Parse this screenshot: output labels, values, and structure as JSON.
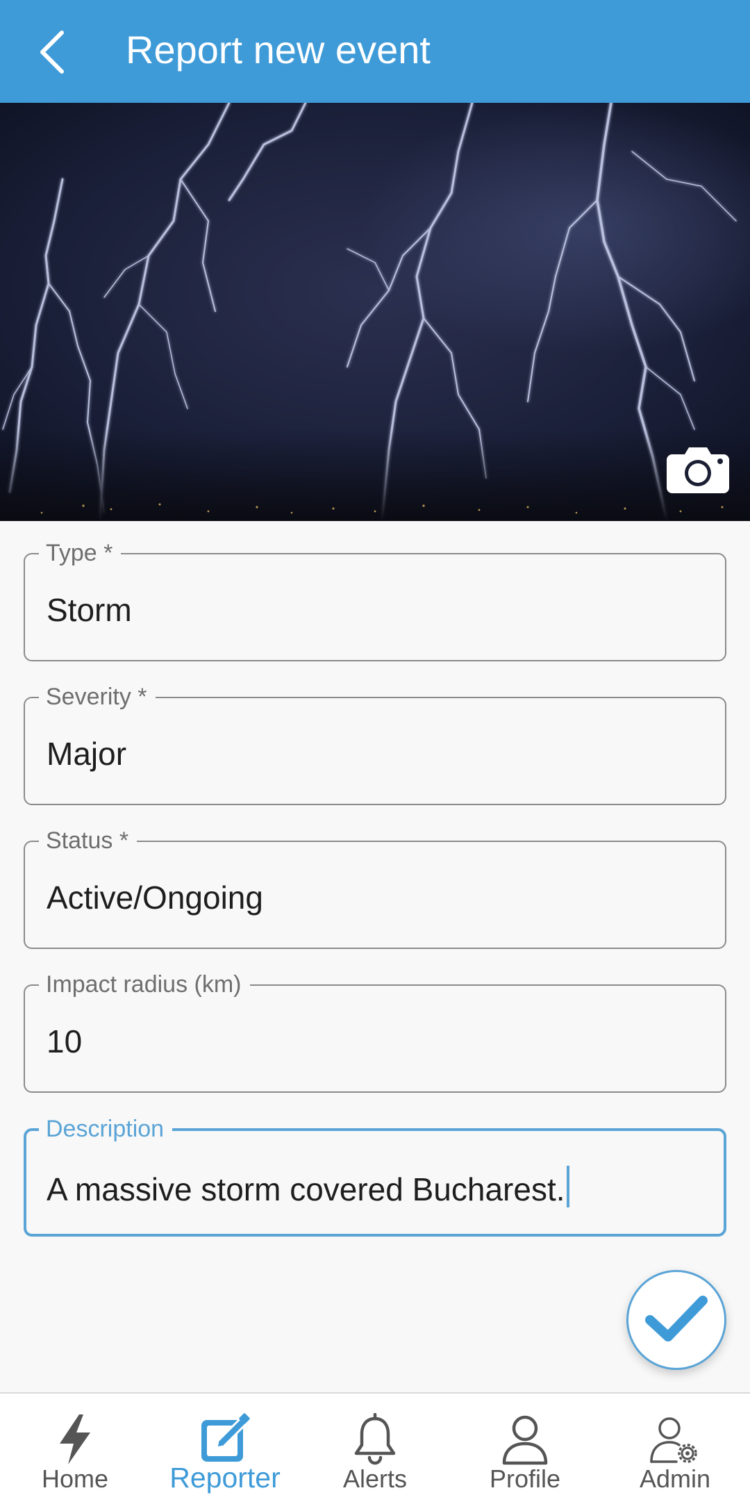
{
  "app": {
    "title": "Report new event",
    "accent_color": "#3f9bd8",
    "back_icon": "chevron-left-icon"
  },
  "hero": {
    "image_icon": "lightning-storm-photo",
    "camera_icon": "camera-icon"
  },
  "form": {
    "fields": [
      {
        "label": "Type *",
        "value": "Storm"
      },
      {
        "label": "Severity *",
        "value": "Major"
      },
      {
        "label": "Status *",
        "value": "Active/Ongoing"
      },
      {
        "label": "Impact radius (km)",
        "value": "10"
      },
      {
        "label": "Description",
        "value": "A massive storm covered Bucharest."
      }
    ],
    "focused_field": "Description",
    "submit_icon": "checkmark-icon"
  },
  "nav": {
    "items": [
      {
        "label": "Home",
        "icon": "lightning-bolt-icon"
      },
      {
        "label": "Reporter",
        "icon": "edit-icon"
      },
      {
        "label": "Alerts",
        "icon": "bell-icon"
      },
      {
        "label": "Profile",
        "icon": "person-icon"
      },
      {
        "label": "Admin",
        "icon": "admin-settings-icon"
      }
    ],
    "active": "Reporter",
    "active_color": "#3f9bd8",
    "inactive_color": "#555555"
  }
}
